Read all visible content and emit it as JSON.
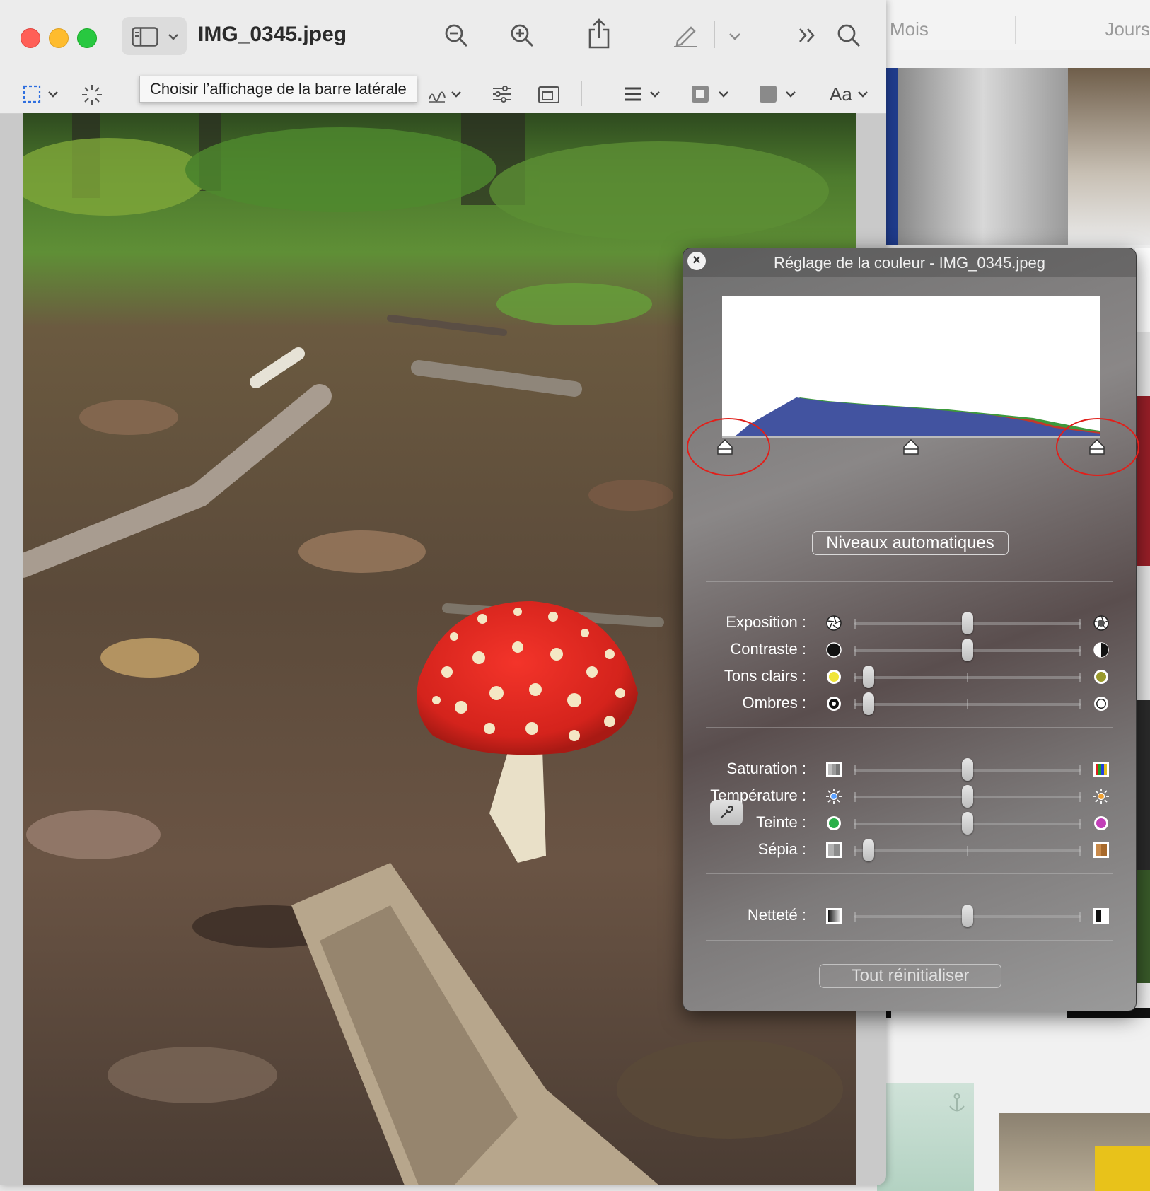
{
  "window": {
    "title": "IMG_0345.jpeg",
    "tooltip": "Choisir l’affichage de la barre latérale",
    "font_menu_label": "Aa"
  },
  "background_app": {
    "tabs": [
      "Mois",
      "Jours"
    ]
  },
  "color_panel": {
    "title": "Réglage de la couleur - IMG_0345.jpeg",
    "auto_levels_label": "Niveaux automatiques",
    "reset_label": "Tout réinitialiser",
    "sliders": [
      {
        "label": "Exposition :",
        "value": 0.5,
        "icon_left": "aperture-closed-icon",
        "icon_right": "aperture-open-icon"
      },
      {
        "label": "Contraste :",
        "value": 0.5,
        "icon_left": "circle-black-icon",
        "icon_right": "circle-half-icon"
      },
      {
        "label": "Tons clairs :",
        "value": 0.02,
        "icon_left": "circle-yellow-icon",
        "icon_right": "circle-olive-icon"
      },
      {
        "label": "Ombres :",
        "value": 0.02,
        "icon_left": "circle-dot-icon",
        "icon_right": "circle-white-icon"
      },
      {
        "label": "Saturation :",
        "value": 0.5,
        "icon_left": "saturation-low-icon",
        "icon_right": "saturation-high-icon"
      },
      {
        "label": "Température :",
        "value": 0.5,
        "icon_left": "sun-blue-icon",
        "icon_right": "sun-orange-icon"
      },
      {
        "label": "Teinte :",
        "value": 0.5,
        "icon_left": "circle-green-icon",
        "icon_right": "circle-magenta-icon"
      },
      {
        "label": "Sépia :",
        "value": 0.02,
        "icon_left": "sepia-low-icon",
        "icon_right": "sepia-high-icon"
      },
      {
        "label": "Netteté :",
        "value": 0.5,
        "icon_left": "sharpness-low-icon",
        "icon_right": "sharpness-high-icon"
      }
    ]
  },
  "colors": {
    "histogram_blue": "#4253a0",
    "histogram_red": "#c0392b",
    "histogram_green": "#3c9a3c",
    "highlight_ring": "#e0201b"
  }
}
